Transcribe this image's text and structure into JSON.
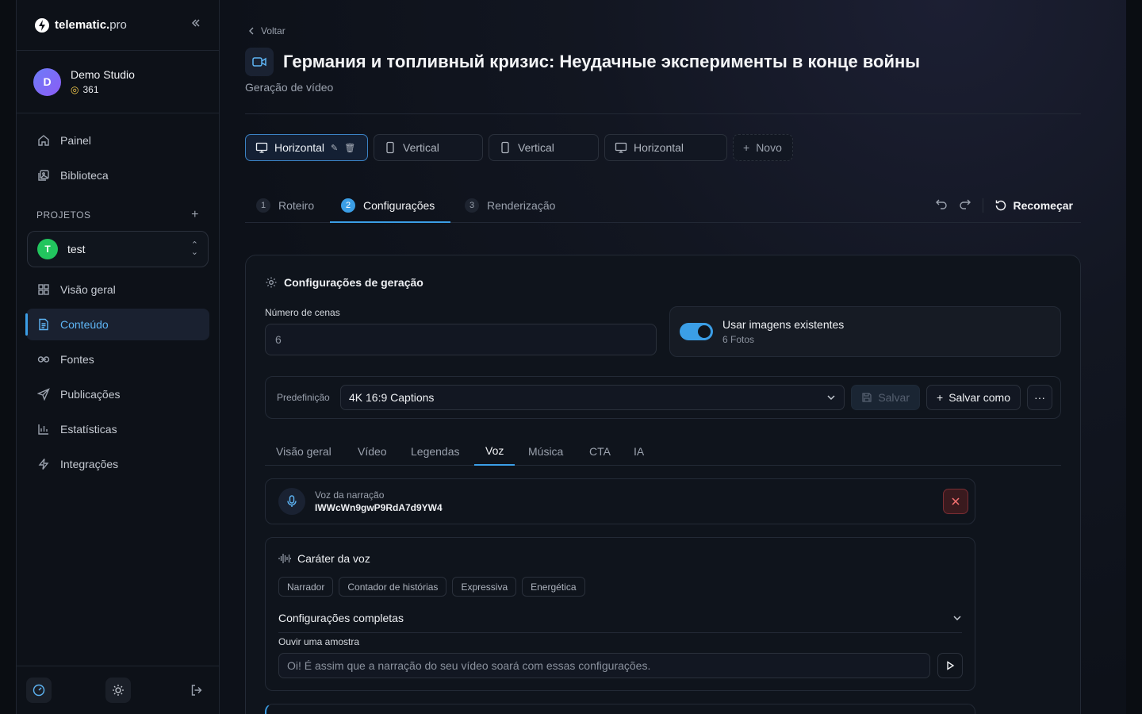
{
  "brand": {
    "name": "telematic.",
    "suffix": "pro"
  },
  "studio": {
    "initial": "D",
    "name": "Demo Studio",
    "credits": "361"
  },
  "nav_main": [
    {
      "label": "Painel",
      "icon": "home-icon"
    },
    {
      "label": "Biblioteca",
      "icon": "library-icon"
    }
  ],
  "projects": {
    "label": "PROJETOS",
    "selected": {
      "initial": "T",
      "name": "test"
    }
  },
  "nav_project": [
    {
      "label": "Visão geral",
      "icon": "grid-icon"
    },
    {
      "label": "Conteúdo",
      "icon": "document-icon",
      "active": true
    },
    {
      "label": "Fontes",
      "icon": "link-icon"
    },
    {
      "label": "Publicações",
      "icon": "send-icon"
    },
    {
      "label": "Estatísticas",
      "icon": "bar-chart-icon"
    },
    {
      "label": "Integrações",
      "icon": "zap-icon"
    }
  ],
  "header": {
    "back": "Voltar",
    "title": "Германия и топливный кризис: Неудачные эксперименты в конце войны",
    "subtitle": "Geração de vídeo"
  },
  "variants": [
    {
      "label": "Horizontal",
      "icon": "monitor-icon",
      "active": true
    },
    {
      "label": "Vertical",
      "icon": "phone-icon"
    },
    {
      "label": "Vertical",
      "icon": "phone-icon"
    },
    {
      "label": "Horizontal",
      "icon": "monitor-icon"
    },
    {
      "label": "Novo",
      "icon": "plus-icon"
    }
  ],
  "steps": [
    {
      "num": "1",
      "label": "Roteiro"
    },
    {
      "num": "2",
      "label": "Configurações",
      "active": true
    },
    {
      "num": "3",
      "label": "Renderização"
    }
  ],
  "restart_label": "Recomeçar",
  "settings": {
    "title": "Configurações de geração",
    "scenes_label": "Número de cenas",
    "scenes_placeholder": "6",
    "toggle_title": "Usar imagens existentes",
    "toggle_sub": "6 Fotos",
    "toggle_on": true,
    "preset_label": "Predefinição",
    "preset_value": "4K 16:9 Captions",
    "save": "Salvar",
    "save_as": "Salvar como"
  },
  "tabs": [
    "Visão geral",
    "Vídeo",
    "Legendas",
    "Voz",
    "Música",
    "CTA",
    "IA"
  ],
  "active_tab": "Voz",
  "voice": {
    "label": "Voz da narração",
    "id": "IWWcWn9gwP9RdA7d9YW4"
  },
  "character": {
    "title": "Caráter da voz",
    "chips": [
      "Narrador",
      "Contador de histórias",
      "Expressiva",
      "Energética"
    ],
    "full_settings": "Configurações completas",
    "sample_label": "Ouvir uma amostra",
    "sample_placeholder": "Oi! É assim que a narração do seu vídeo soará com essas configurações."
  },
  "colors": {
    "accent": "#3b9ee6",
    "danger": "#f87171",
    "project_avatar": "#22c55e"
  }
}
